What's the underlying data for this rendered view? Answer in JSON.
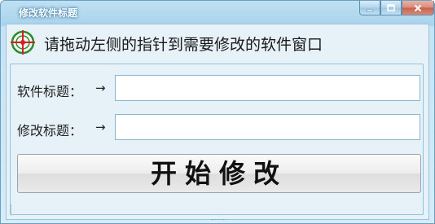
{
  "window": {
    "title": "修改软件标题",
    "controls": {
      "minimize_icon": "minimize-icon",
      "maximize_icon": "maximize-icon",
      "close_icon": "close-icon"
    }
  },
  "header": {
    "icon": "crosshair-target-icon",
    "instruction": "请拖动左侧的指针到需要修改的软件窗口"
  },
  "form": {
    "software_title_label": "软件标题：",
    "software_title_arrow": "→",
    "software_title_value": "",
    "modify_title_label": "修改标题：",
    "modify_title_arrow": "→",
    "modify_title_value": "",
    "start_button_label": "开始修改"
  },
  "colors": {
    "titlebar": "#a9d3ec",
    "client_bg": "#e7f1f8",
    "crosshair_green": "#2e8b2e",
    "crosshair_red": "#d62020",
    "close_button": "#c7604a"
  }
}
